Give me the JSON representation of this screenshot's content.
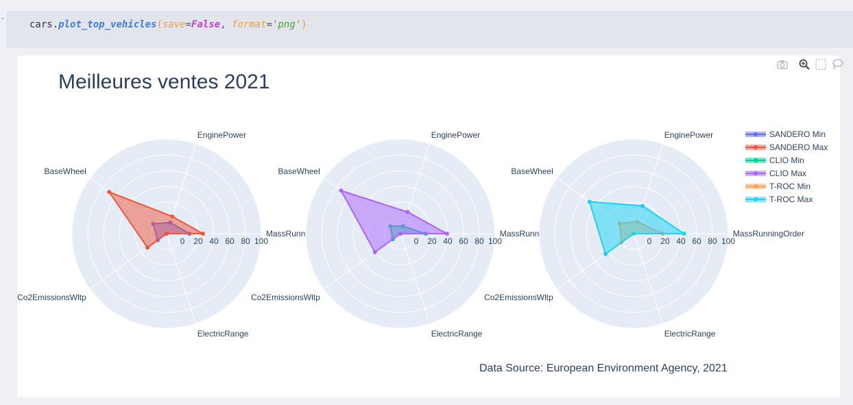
{
  "code_cell": {
    "tokens": [
      {
        "t": "cars",
        "c": "tok-obj"
      },
      {
        "t": ".",
        "c": "tok-dot"
      },
      {
        "t": "plot_top_vehicles",
        "c": "tok-fn"
      },
      {
        "t": "(",
        "c": "tok-paren"
      },
      {
        "t": "save",
        "c": "tok-param"
      },
      {
        "t": "=",
        "c": "tok-eq"
      },
      {
        "t": "False",
        "c": "tok-kw"
      },
      {
        "t": ", ",
        "c": "tok-comma"
      },
      {
        "t": "format",
        "c": "tok-param"
      },
      {
        "t": "=",
        "c": "tok-eq"
      },
      {
        "t": "'png'",
        "c": "tok-str"
      },
      {
        "t": ")",
        "c": "tok-paren"
      }
    ]
  },
  "modebar": {
    "icons": [
      "camera-icon",
      "zoom-icon",
      "select-box-icon",
      "lasso-icon",
      "plotly-logo-icon"
    ]
  },
  "chart_data": {
    "type": "radar",
    "title": "Meilleures ventes 2021",
    "annotation": "Data Source: European Environment Agency, 2021",
    "axes": [
      "MassRunningOrder",
      "EnginePower",
      "BaseWheel",
      "Co2EmissionsWltp",
      "ElectricRange"
    ],
    "axis_labels_displayed": [
      [
        "MassRunni",
        "EnginePower",
        "BaseWheel",
        "Co2EmissionsWltp",
        "ElectricRange"
      ],
      [
        "MassRunni",
        "EnginePower",
        "BaseWheel",
        "Co2EmissionsWltp",
        "ElectricRange"
      ],
      [
        "MassRunningOrder",
        "EnginePower",
        "BaseWheel",
        "Co2EmissionsWltp",
        "ElectricRange"
      ]
    ],
    "radial_range": [
      -20,
      100
    ],
    "radial_ticks": [
      "0",
      "20",
      "40",
      "60",
      "80",
      "100"
    ],
    "radial_tick_values": [
      0,
      20,
      40,
      60,
      80,
      100
    ],
    "legend_position": "top-right",
    "polars": [
      {
        "series": [
          {
            "name": "SANDERO Min",
            "color": "#636efa",
            "values": [
              9,
              -5,
              1,
              -6,
              -20
            ]
          },
          {
            "name": "SANDERO Max",
            "color": "#ef553b",
            "values": [
              26,
              3,
              70,
              10,
              -20
            ]
          }
        ]
      },
      {
        "series": [
          {
            "name": "CLIO Min",
            "color": "#00cc96",
            "values": [
              12,
              -10,
              -4,
              -8,
              -20
            ]
          },
          {
            "name": "CLIO Max",
            "color": "#ab63fa",
            "values": [
              39,
              9,
              73,
              20,
              -20
            ]
          }
        ]
      },
      {
        "series": [
          {
            "name": "T-ROC Min",
            "color": "#ffa15a",
            "values": [
              17,
              -4,
              2,
              -1,
              -20
            ]
          },
          {
            "name": "T-ROC Max",
            "color": "#19d3f3",
            "values": [
              44,
              17,
              49,
              24,
              -20
            ]
          }
        ]
      }
    ]
  }
}
